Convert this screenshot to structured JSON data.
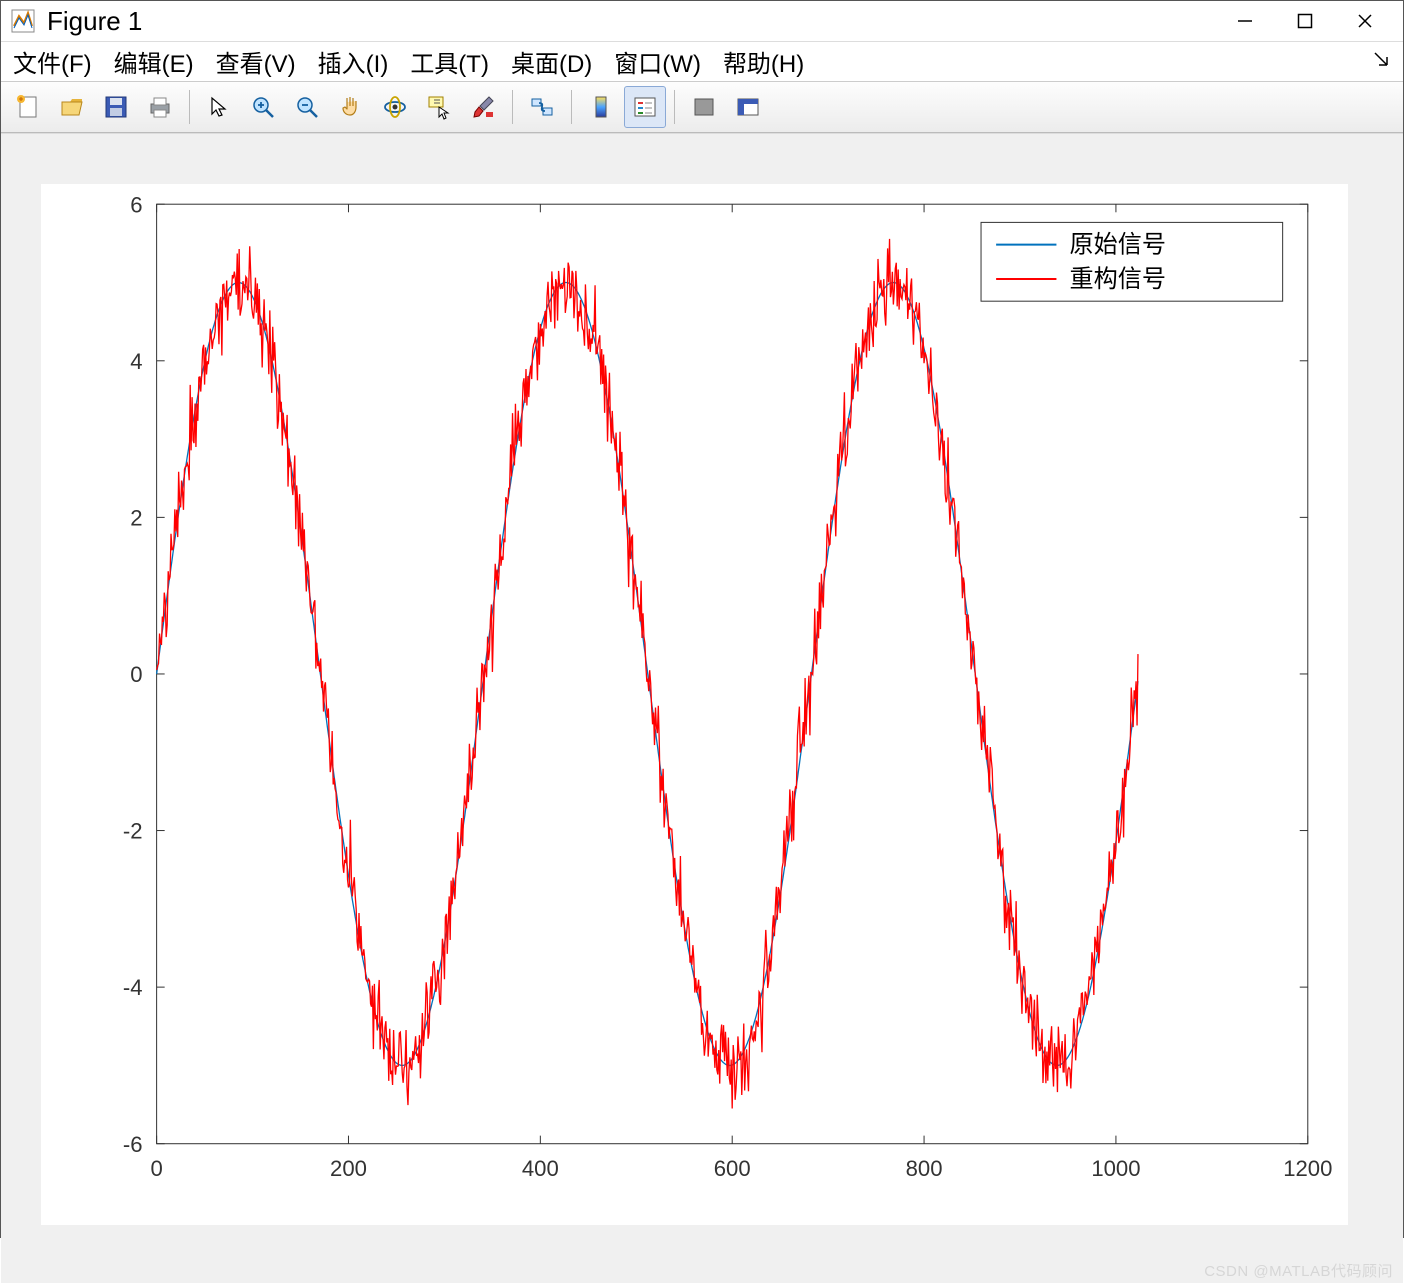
{
  "window": {
    "title": "Figure 1"
  },
  "menus": {
    "file": "文件(F)",
    "edit": "编辑(E)",
    "view": "查看(V)",
    "insert": "插入(I)",
    "tools": "工具(T)",
    "desktop": "桌面(D)",
    "window": "窗口(W)",
    "help": "帮助(H)"
  },
  "toolbar_icons": [
    "new-figure-icon",
    "open-icon",
    "save-icon",
    "print-icon",
    "sep",
    "pointer-icon",
    "zoom-in-icon",
    "zoom-out-icon",
    "pan-icon",
    "rotate-3d-icon",
    "datacursor-icon",
    "brush-icon",
    "sep",
    "link-icon",
    "sep",
    "colorbar-icon",
    "legend-icon",
    "sep",
    "hide-plot-tools-icon",
    "dock-app-icon"
  ],
  "legend": {
    "series1": "原始信号",
    "series2": "重构信号"
  },
  "watermark": "CSDN @MATLAB代码顾问",
  "chart_data": {
    "type": "line",
    "title": "",
    "xlabel": "",
    "ylabel": "",
    "xlim": [
      0,
      1200
    ],
    "ylim": [
      -6,
      6
    ],
    "xticks": [
      0,
      200,
      400,
      600,
      800,
      1000,
      1200
    ],
    "yticks": [
      -6,
      -4,
      -2,
      0,
      2,
      4,
      6
    ],
    "samples": 1024,
    "series": [
      {
        "name": "原始信号",
        "color": "#0072BD",
        "formula": "5*sin(3*2*pi*x/1024)",
        "amplitude": 5,
        "periods": 3,
        "noise_sigma": 0
      },
      {
        "name": "重构信号",
        "color": "#FF0000",
        "formula": "5*sin(3*2*pi*x/1024) + noise",
        "amplitude": 5,
        "periods": 3,
        "noise_sigma": 0.25
      }
    ],
    "note": "Two series overlap; the red reconstructed signal visually covers the blue original signal. Approx. value range observed: peaks ≈ 5.8, troughs ≈ -5.0."
  }
}
